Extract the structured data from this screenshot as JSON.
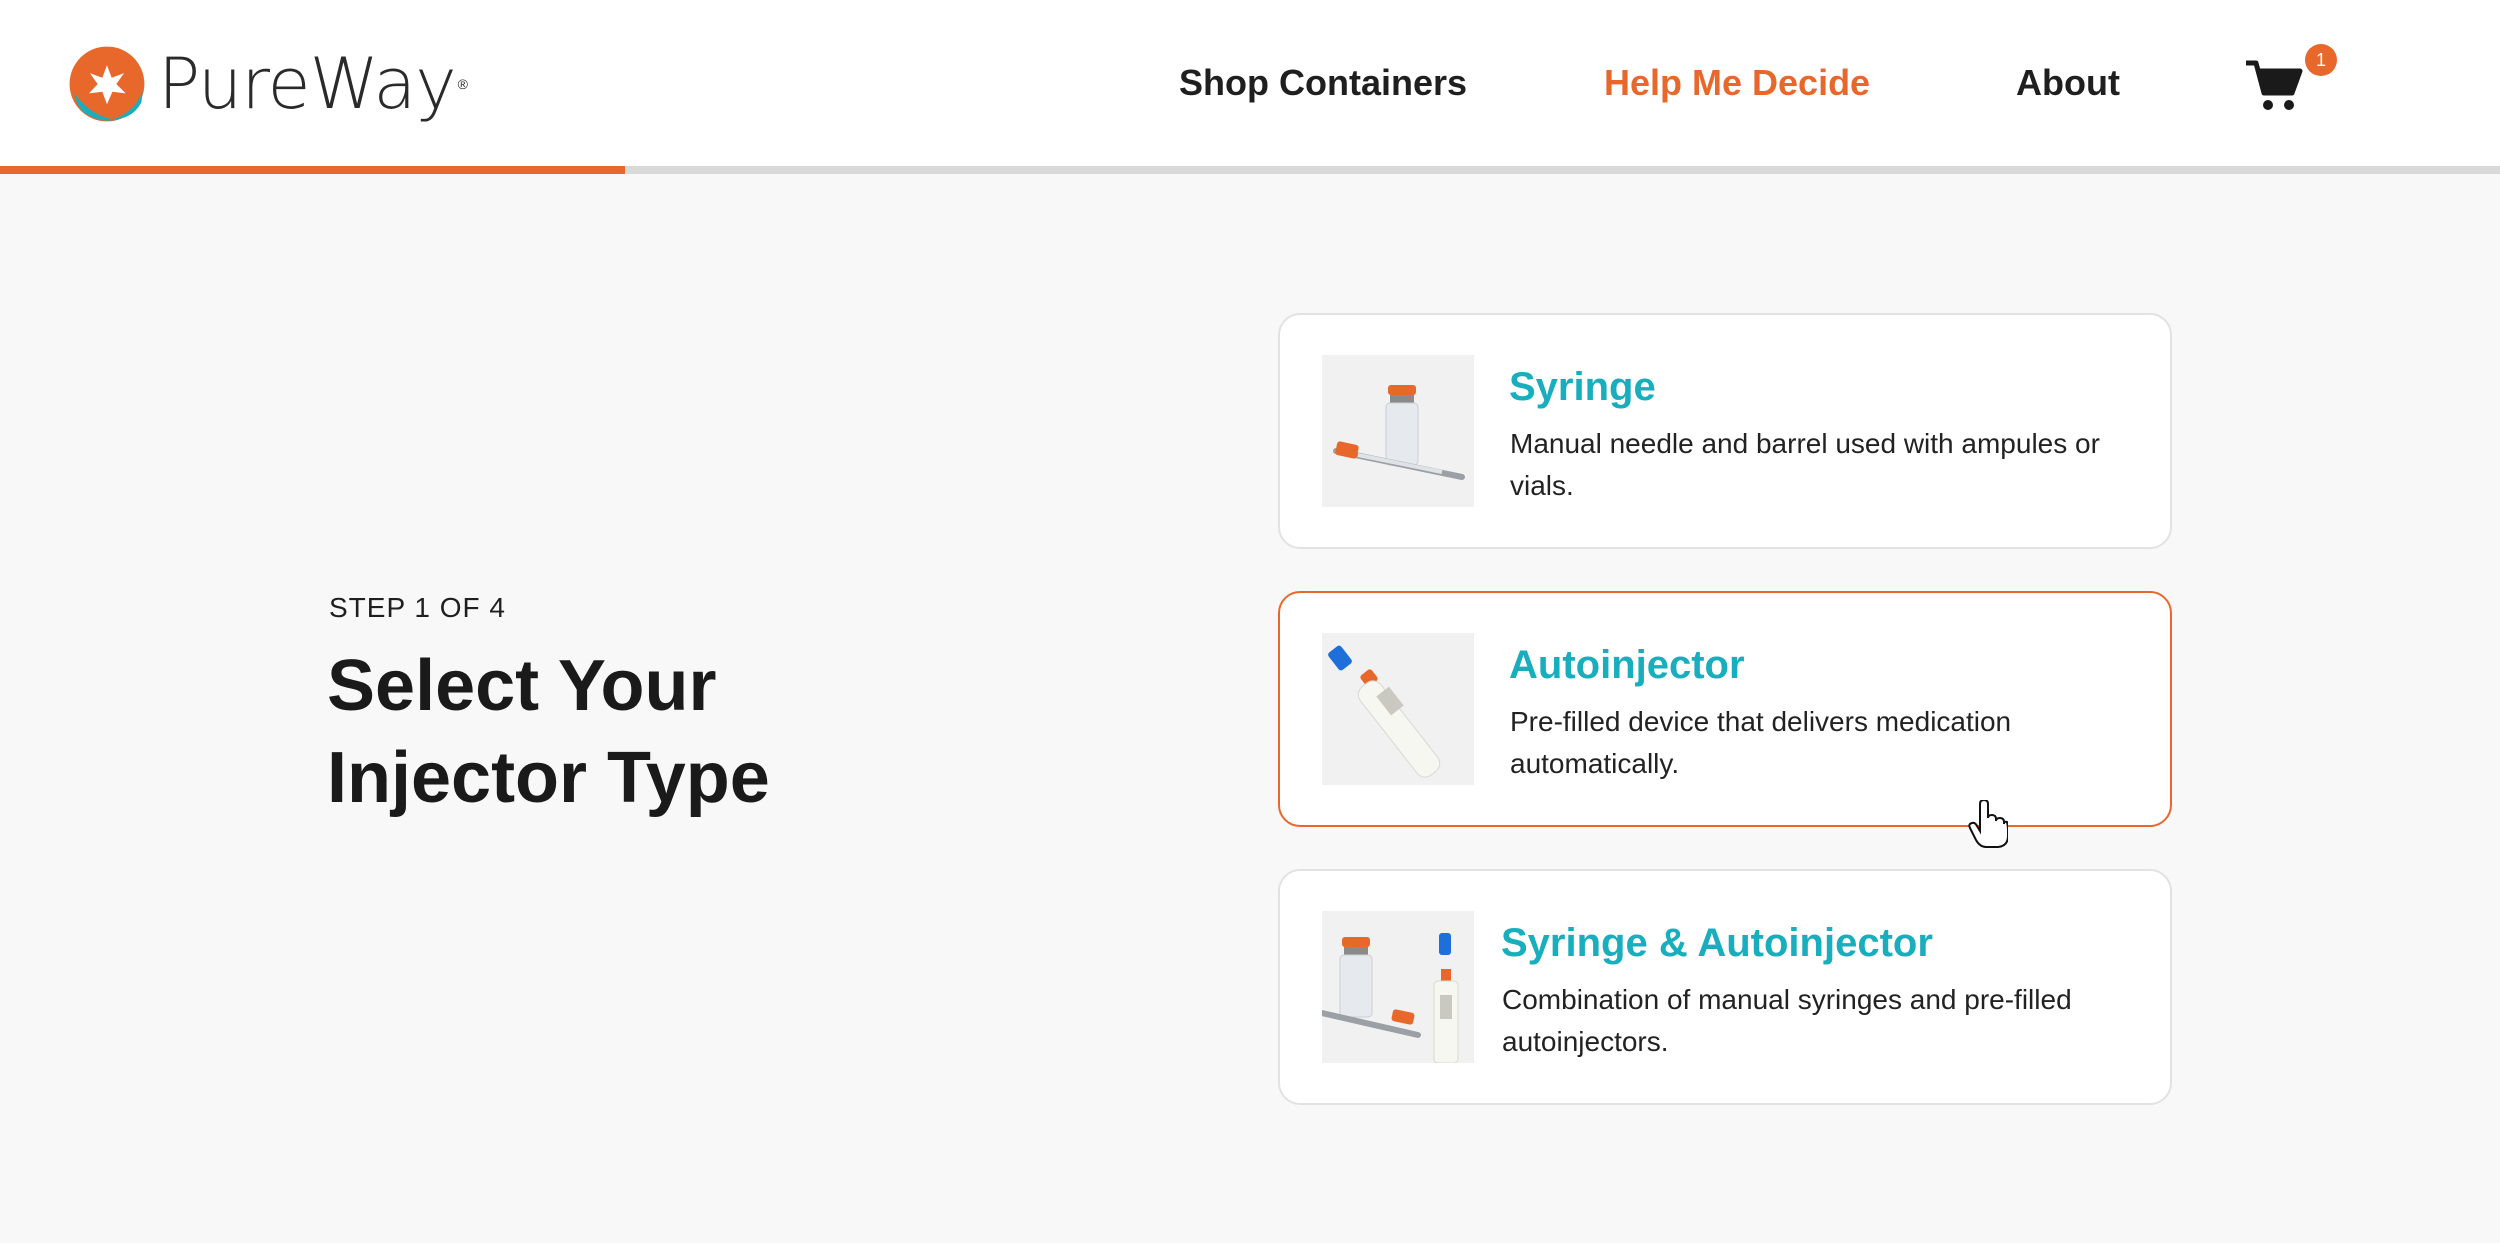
{
  "brand": {
    "name": "PureWay",
    "registered": "®",
    "colors": {
      "orange": "#e8682b",
      "teal": "#19aebd"
    }
  },
  "nav": {
    "shop_label": "Shop Containers",
    "help_label": "Help Me Decide",
    "about_label": "About",
    "cart_count": "1",
    "cart_icon": "cart-icon"
  },
  "progress": {
    "fraction": 0.25
  },
  "step": {
    "label": "STEP 1 OF 4",
    "title_line1": "Select Your",
    "title_line2": "Injector Type"
  },
  "options": [
    {
      "title": "Syringe",
      "description": "Manual needle and barrel used with ampules or vials.",
      "icon": "syringe-vial-image"
    },
    {
      "title": "Autoinjector",
      "description": "Pre-filled device that delivers medication automatically.",
      "icon": "autoinjector-image",
      "selected": true
    },
    {
      "title": "Syringe & Autoinjector",
      "description": "Combination of manual syringes and pre-filled autoinjectors.",
      "icon": "syringe-autoinjector-image"
    }
  ]
}
